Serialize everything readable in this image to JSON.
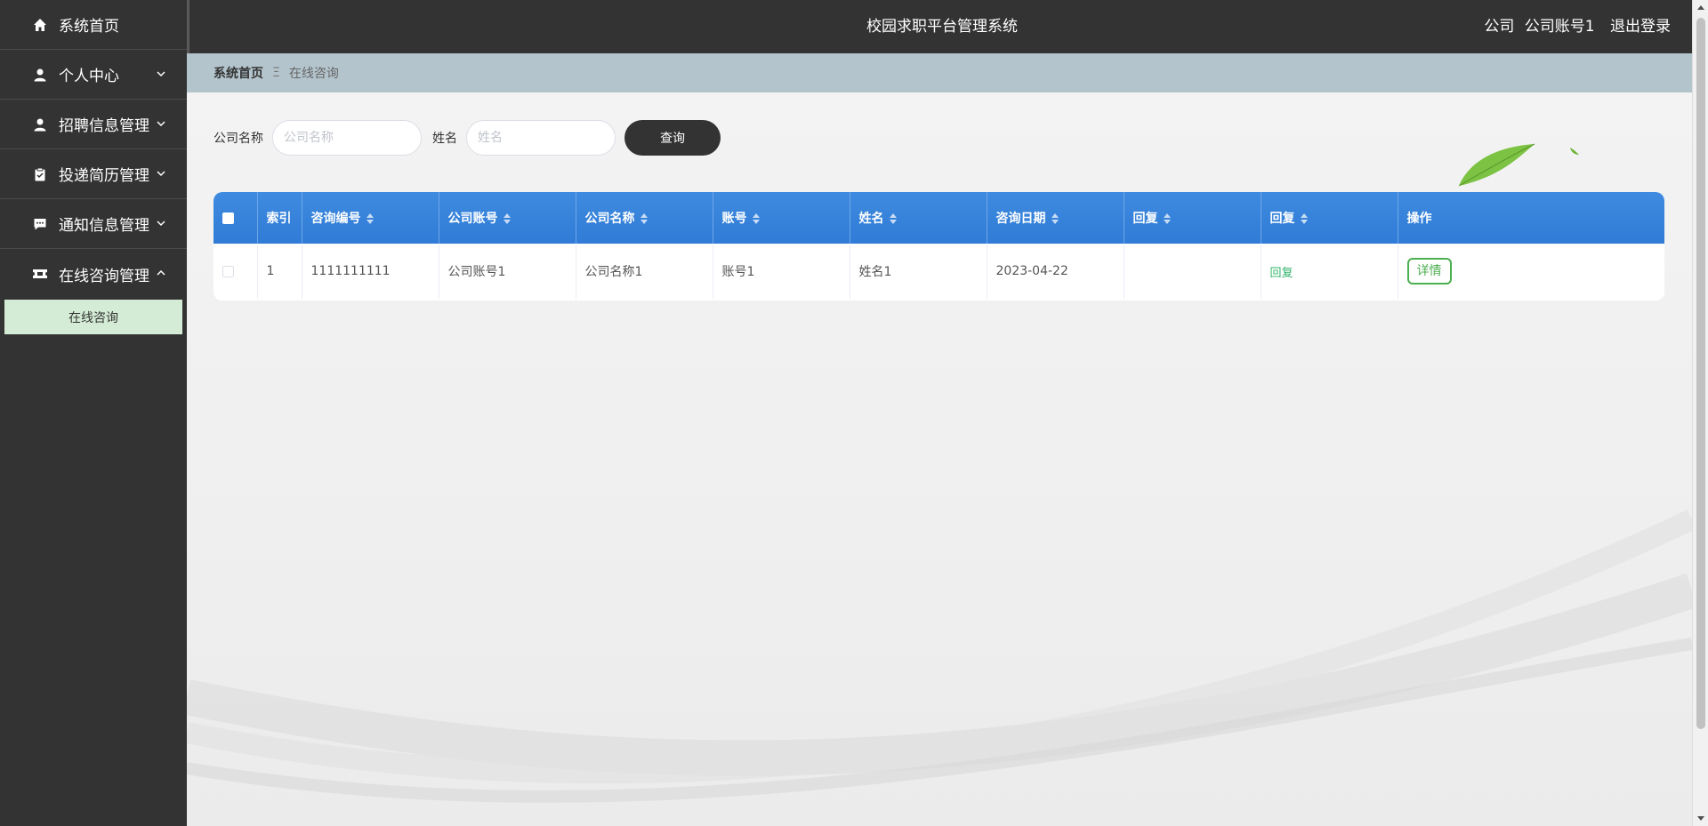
{
  "sidebar": {
    "items": [
      {
        "label": "系统首页",
        "icon": "home-icon",
        "expanded": null
      },
      {
        "label": "个人中心",
        "icon": "user-icon",
        "expanded": false
      },
      {
        "label": "招聘信息管理",
        "icon": "user-icon",
        "expanded": false
      },
      {
        "label": "投递简历管理",
        "icon": "clipboard-icon",
        "expanded": false
      },
      {
        "label": "通知信息管理",
        "icon": "message-icon",
        "expanded": false
      },
      {
        "label": "在线咨询管理",
        "icon": "ticket-icon",
        "expanded": true
      }
    ],
    "sub_item": "在线咨询"
  },
  "header": {
    "title": "校园求职平台管理系统",
    "role": "公司",
    "account": "公司账号1",
    "logout": "退出登录"
  },
  "breadcrumb": {
    "home": "系统首页",
    "separator": "Ξ",
    "current": "在线咨询"
  },
  "search": {
    "company_label": "公司名称",
    "company_placeholder": "公司名称",
    "name_label": "姓名",
    "name_placeholder": "姓名",
    "query_button": "查询"
  },
  "table": {
    "columns": [
      "索引",
      "咨询编号",
      "公司账号",
      "公司名称",
      "账号",
      "姓名",
      "咨询日期",
      "回复",
      "回复",
      "操作"
    ],
    "rows": [
      {
        "index": "1",
        "consult_no": "1111111111",
        "company_account": "公司账号1",
        "company_name": "公司名称1",
        "account": "账号1",
        "name": "姓名1",
        "date": "2023-04-22",
        "reply_text": "",
        "reply_link": "回复",
        "action": "详情"
      }
    ]
  },
  "colors": {
    "sidebar_bg": "#333333",
    "header_bg": "#333333",
    "breadcrumb_bg": "#b3c4cc",
    "table_header": "#3585dc",
    "active_sub_bg": "#d4ecd5",
    "detail_green": "#4caf50"
  }
}
